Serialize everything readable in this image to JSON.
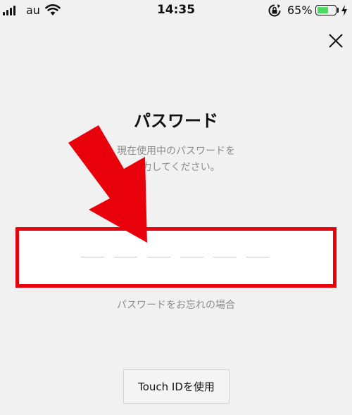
{
  "status_bar": {
    "carrier": "au",
    "time": "14:35",
    "battery_percent": "65%",
    "battery_level": 0.65,
    "icons": [
      "signal-icon",
      "wifi-icon",
      "rotation-lock-icon",
      "battery-icon",
      "charging-bolt-icon"
    ]
  },
  "header": {
    "close_icon": "close-icon"
  },
  "main": {
    "title": "パスワード",
    "instruction_line1": "現在使用中のパスワードを",
    "instruction_line2": "入力してください。",
    "password_slots": 6,
    "forgot_link": "パスワードをお忘れの場合",
    "touch_id_button": "Touch IDを使用"
  },
  "annotation": {
    "arrow_color": "#e8000b",
    "highlight_color": "#e8000b"
  }
}
